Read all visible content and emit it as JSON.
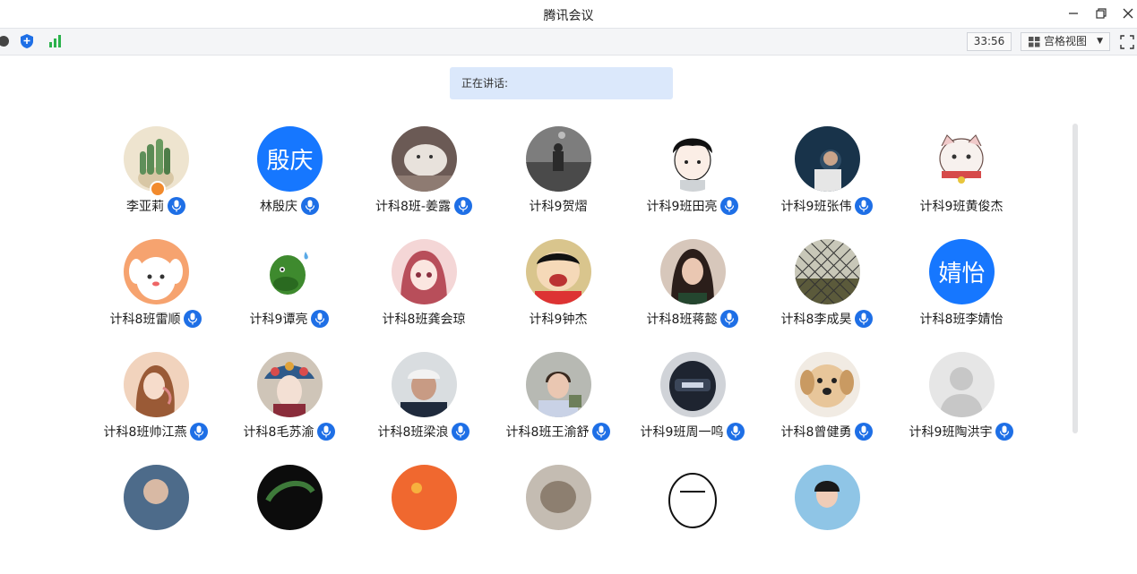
{
  "window": {
    "title": "腾讯会议"
  },
  "toolbar": {
    "timer": "33:56",
    "view_label": "宫格视图",
    "signal_icon": "signal-bars-icon",
    "shield_icon": "shield-icon"
  },
  "speaking": {
    "label": "正在讲话:"
  },
  "colors": {
    "accent": "#1e6fe6",
    "speaking_bg": "#dbe8fb",
    "text_avatar_bg": "#1677ff"
  },
  "participants": [
    {
      "name": "李亚莉",
      "avatar": "cactus-photo",
      "mic": true,
      "host": true
    },
    {
      "name": "林殷庆",
      "avatar_text": "殷庆",
      "mic": true
    },
    {
      "name": "计科8班-姜露",
      "avatar": "dog-photo",
      "mic": true
    },
    {
      "name": "计科9贺熠",
      "avatar": "street-photo",
      "mic": false
    },
    {
      "name": "计科9班田亮",
      "avatar": "cartoon-boy",
      "mic": true
    },
    {
      "name": "计科9班张伟",
      "avatar": "dark-photo",
      "mic": true
    },
    {
      "name": "计科9班黄俊杰",
      "avatar": "cartoon-cat",
      "mic": false
    },
    {
      "name": "计科8班雷顺",
      "avatar": "cartoon-puppy",
      "mic": true
    },
    {
      "name": "计科9谭亮",
      "avatar": "dinosaur",
      "mic": true
    },
    {
      "name": "计科8班龚会琼",
      "avatar": "anime-girl",
      "mic": false
    },
    {
      "name": "计科9钟杰",
      "avatar": "cartoon-kid",
      "mic": false
    },
    {
      "name": "计科8班蒋懿",
      "avatar": "girl-photo",
      "mic": true
    },
    {
      "name": "计科8李成昊",
      "avatar": "fence-photo",
      "mic": true
    },
    {
      "name": "计科8班李婧怡",
      "avatar_text": "婧怡",
      "mic": false
    },
    {
      "name": "计科8班帅江燕",
      "avatar": "woman-photo",
      "mic": true
    },
    {
      "name": "计科8毛苏渝",
      "avatar": "opera-art",
      "mic": true
    },
    {
      "name": "计科8班梁浪",
      "avatar": "man-cap-photo",
      "mic": true
    },
    {
      "name": "计科8班王渝舒",
      "avatar": "boy-photo",
      "mic": true
    },
    {
      "name": "计科9班周一鸣",
      "avatar": "helmet-photo",
      "mic": true
    },
    {
      "name": "计科8曾健勇",
      "avatar": "dog-face-photo",
      "mic": true
    },
    {
      "name": "计科9班陶洪宇",
      "avatar": "default-person",
      "mic": true
    },
    {
      "name": "",
      "avatar": "partial-1",
      "mic": false
    },
    {
      "name": "",
      "avatar": "partial-2",
      "mic": false
    },
    {
      "name": "",
      "avatar": "partial-3",
      "mic": false
    },
    {
      "name": "",
      "avatar": "partial-4",
      "mic": false
    },
    {
      "name": "",
      "avatar": "partial-5",
      "mic": false
    },
    {
      "name": "",
      "avatar": "partial-6",
      "mic": false
    }
  ]
}
